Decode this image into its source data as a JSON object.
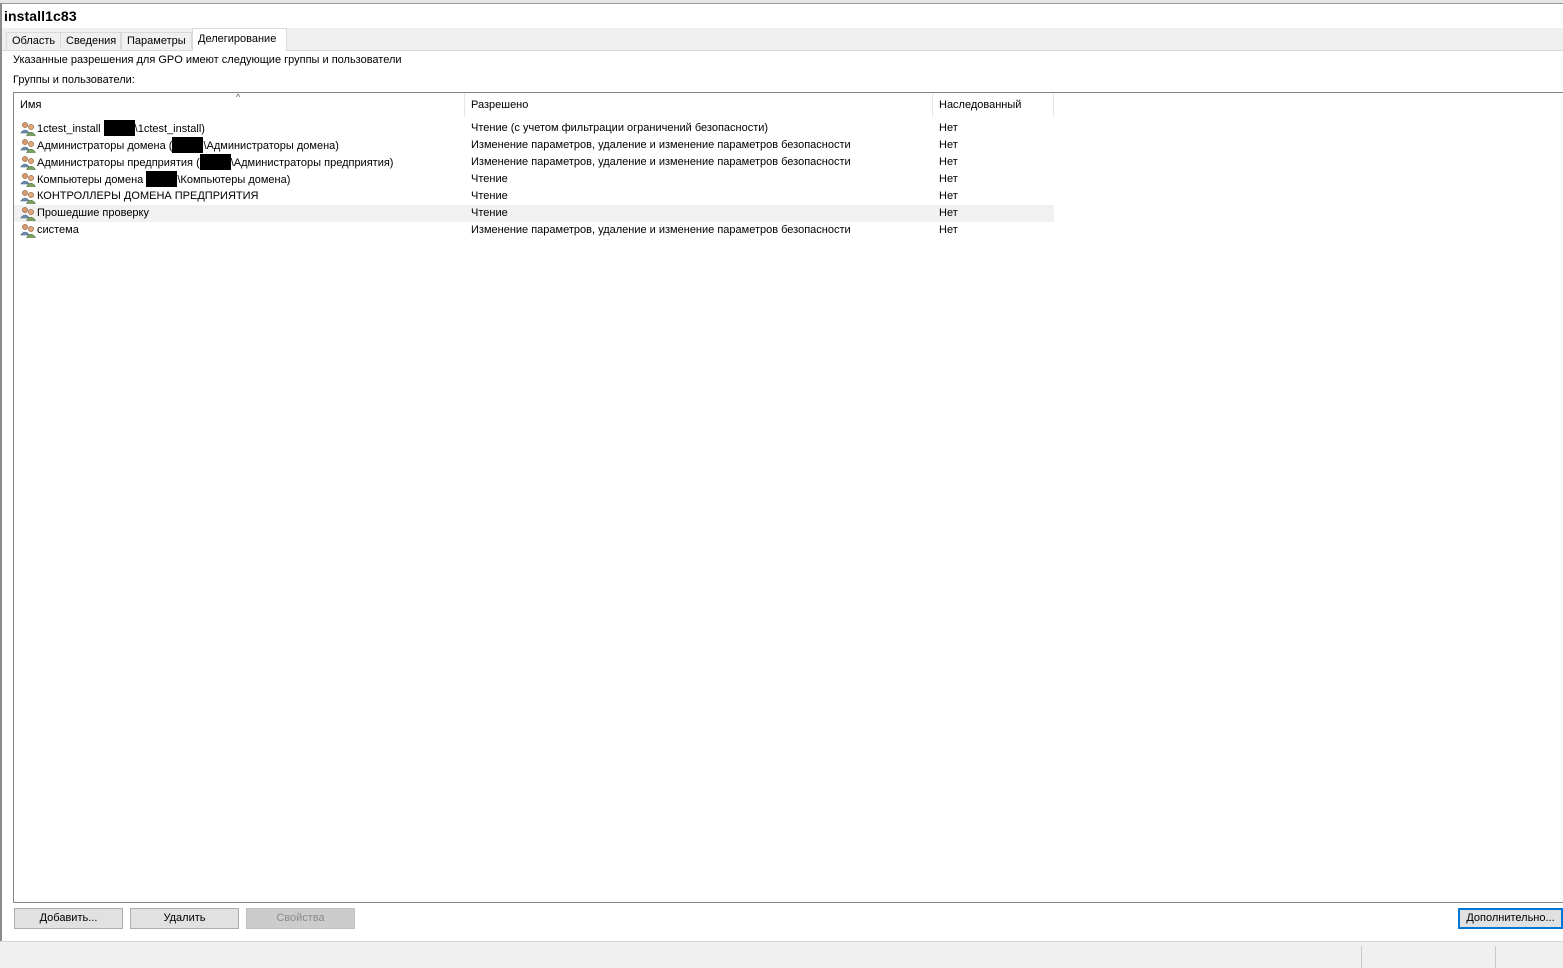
{
  "window": {
    "title": "install1c83"
  },
  "tabs": [
    {
      "label": "Область"
    },
    {
      "label": "Сведения"
    },
    {
      "label": "Параметры"
    },
    {
      "label": "Делегирование"
    }
  ],
  "delegation": {
    "description": "Указанные разрешения для GPO имеют следующие группы и пользователи",
    "list_label": "Группы и пользователи:",
    "columns": {
      "name": "Имя",
      "permission": "Разрешено",
      "inherited": "Наследованный"
    },
    "sort_indicator": "^",
    "rows": [
      {
        "name_prefix": "1ctest_install ",
        "name_suffix": "\\1ctest_install)",
        "redacted": true,
        "permission": "Чтение (с учетом фильтрации ограничений безопасности)",
        "inherited": "Нет",
        "icon": "user-group-icon"
      },
      {
        "name_prefix": "Администраторы домена (",
        "name_suffix": "\\Администраторы домена)",
        "redacted": true,
        "permission": "Изменение параметров, удаление и изменение параметров безопасности",
        "inherited": "Нет",
        "icon": "user-group-icon"
      },
      {
        "name_prefix": "Администраторы предприятия (",
        "name_suffix": "\\Администраторы предприятия)",
        "redacted": true,
        "permission": "Изменение параметров, удаление и изменение параметров безопасности",
        "inherited": "Нет",
        "icon": "user-group-icon"
      },
      {
        "name_prefix": "Компьютеры домена ",
        "name_suffix": "\\Компьютеры домена)",
        "redacted": true,
        "permission": "Чтение",
        "inherited": "Нет",
        "icon": "user-group-icon"
      },
      {
        "name_prefix": "КОНТРОЛЛЕРЫ ДОМЕНА ПРЕДПРИЯТИЯ",
        "name_suffix": "",
        "redacted": false,
        "permission": "Чтение",
        "inherited": "Нет",
        "icon": "user-group-icon"
      },
      {
        "name_prefix": "Прошедшие проверку",
        "name_suffix": "",
        "redacted": false,
        "permission": "Чтение",
        "inherited": "Нет",
        "icon": "user-group-icon",
        "selected": true
      },
      {
        "name_prefix": "система",
        "name_suffix": "",
        "redacted": false,
        "permission": "Изменение параметров, удаление и изменение параметров безопасности",
        "inherited": "Нет",
        "icon": "user-group-icon"
      }
    ]
  },
  "buttons": {
    "add": "Добавить...",
    "remove": "Удалить",
    "properties": "Свойства",
    "advanced": "Дополнительно..."
  }
}
